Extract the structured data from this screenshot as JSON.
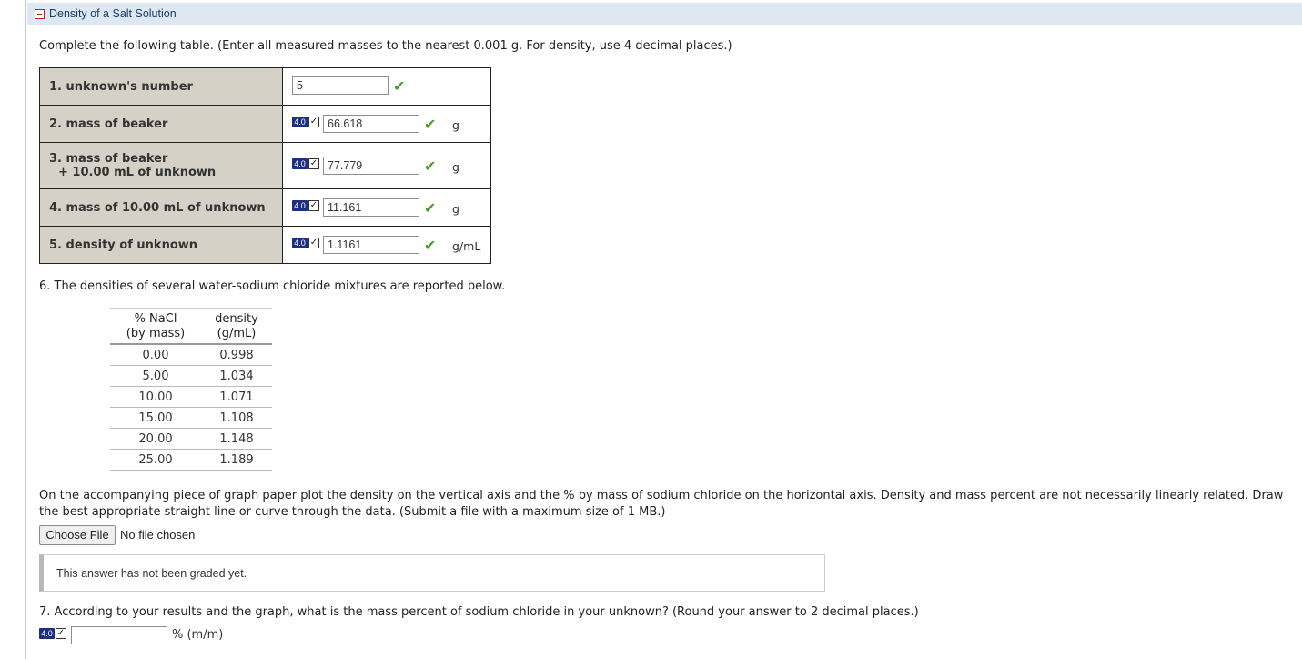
{
  "section": {
    "title": "Density of a Salt Solution"
  },
  "instructions": "Complete the following table. (Enter all measured masses to the nearest 0.001 g. For density, use 4 decimal places.)",
  "rows": [
    {
      "label": "1. unknown's number",
      "value": "5",
      "unit": ""
    },
    {
      "label": "2. mass of beaker",
      "badge": "4.0",
      "value": "66.618",
      "unit": "g"
    },
    {
      "label_line1": "3. mass of beaker",
      "label_line2": "+ 10.00 mL of unknown",
      "badge": "4.0",
      "value": "77.779",
      "unit": "g"
    },
    {
      "label": "4. mass of 10.00 mL of unknown",
      "badge": "4.0",
      "value": "11.161",
      "unit": "g"
    },
    {
      "label": "5. density of unknown",
      "badge": "4.0",
      "value": "1.1161",
      "unit": "g/mL"
    }
  ],
  "q6": {
    "text": "6. The densities of several water-sodium chloride mixtures are reported below.",
    "headers": [
      {
        "line1": "% NaCl",
        "line2": "(by mass)"
      },
      {
        "line1": "density",
        "line2": "(g/mL)"
      }
    ],
    "table": [
      [
        "0.00",
        "0.998"
      ],
      [
        "5.00",
        "1.034"
      ],
      [
        "10.00",
        "1.071"
      ],
      [
        "15.00",
        "1.108"
      ],
      [
        "20.00",
        "1.148"
      ],
      [
        "25.00",
        "1.189"
      ]
    ]
  },
  "graph": {
    "text": "On the accompanying piece of graph paper plot the density on the vertical axis and the % by mass of sodium chloride on the horizontal axis. Density and mass percent are not necessarily linearly related. Draw the best appropriate straight line or curve through the data. (Submit a file with a maximum size of 1 MB.)",
    "choose_file": "Choose File",
    "file_status": "No file chosen",
    "grade_status": "This answer has not been graded yet."
  },
  "q7": {
    "text": "7. According to your results and the graph, what is the mass percent of sodium chloride in your unknown? (Round your answer to 2 decimal places.)",
    "badge": "4.0",
    "value": "",
    "unit": "% (m/m)"
  },
  "colors": {
    "header_bg": "#dde8f2",
    "label_bg": "#d5d1c7",
    "badge": "#1c2f86",
    "check": "#4a9a2a"
  }
}
